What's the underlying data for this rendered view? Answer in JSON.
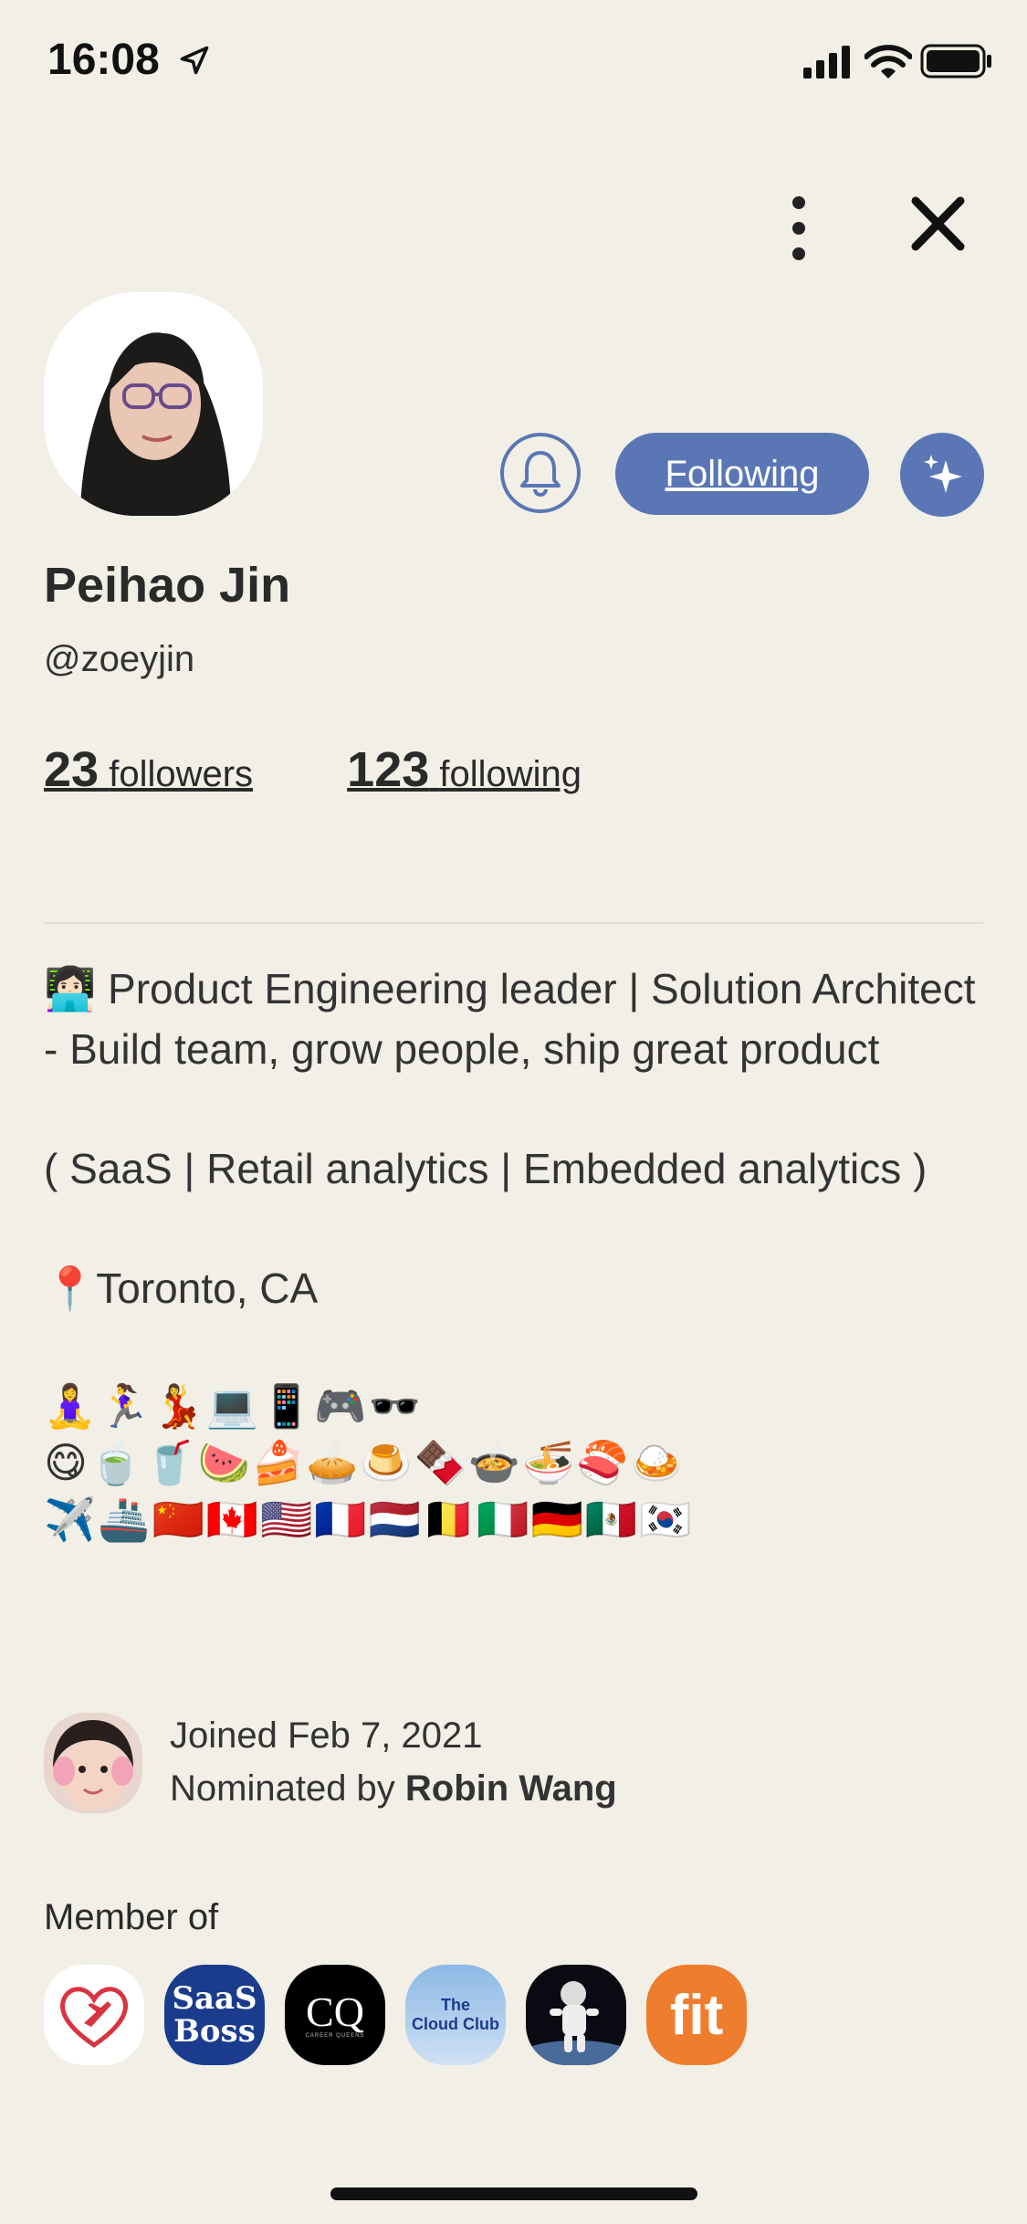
{
  "status": {
    "time": "16:08"
  },
  "profile": {
    "name": "Peihao Jin",
    "handle": "@zoeyjin",
    "followers_count": "23",
    "followers_label": "followers",
    "following_count": "123",
    "following_label": "following"
  },
  "actions": {
    "following_label": "Following"
  },
  "bio": {
    "line1": "👩🏻‍💻 Product Engineering leader | Solution Architect - Build team, grow people, ship great product",
    "line2": "( SaaS | Retail analytics | Embedded analytics )",
    "line3": "📍Toronto, CA",
    "emoji_row1": "🧘‍♀️🏃‍♀️💃💻📱🎮🕶️",
    "emoji_row2": "😋🍵🥤🍉🍰🥧🍮🍫🍲🍜🍣🍛",
    "emoji_row3": "✈️🚢🇨🇳🇨🇦🇺🇸🇫🇷🇳🇱🇧🇪🇮🇹🇩🇪🇲🇽🇰🇷"
  },
  "joined": {
    "date_text": "Joined Feb 7, 2021",
    "nominated_prefix": "Nominated by",
    "nominated_by": "Robin Wang"
  },
  "members": {
    "label": "Member of",
    "clubs": [
      {
        "name": "heart-plane-club"
      },
      {
        "name": "saas-boss-club",
        "text_line1": "SaaS",
        "text_line2": "Boss"
      },
      {
        "name": "cq-club",
        "text": "CQ",
        "subtext": "CAREER QUEENS"
      },
      {
        "name": "cloud-club",
        "text_line1": "The",
        "text_line2": "Cloud Club"
      },
      {
        "name": "astronaut-club"
      },
      {
        "name": "fit-club",
        "text": "fit"
      }
    ]
  },
  "colors": {
    "accent": "#5a76b5",
    "background": "#f1efe6",
    "fit_orange": "#ef7d2e",
    "saas_blue": "#1b3c8c"
  }
}
